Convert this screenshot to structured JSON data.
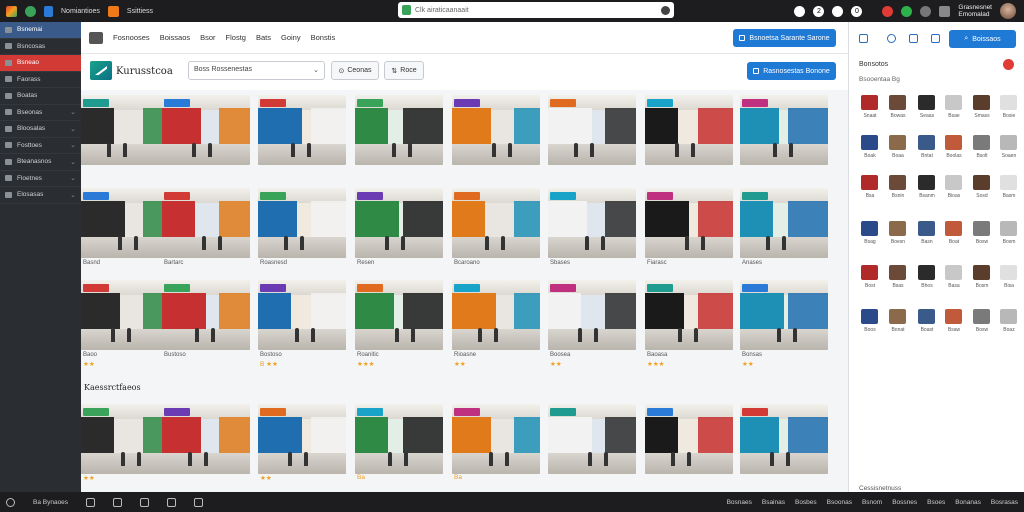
{
  "topbar": {
    "items": [
      {
        "icon": "app-logo-icon",
        "color": "#e8412c",
        "label": ""
      },
      {
        "icon": "leaf-icon",
        "color": "#3aa35a",
        "label": ""
      },
      {
        "icon": "bookmark-icon",
        "color": "#2a7ad8",
        "label": "Nomiantioes"
      },
      {
        "icon": "puzzle-icon",
        "color": "#f07a1a",
        "label": "Ssittiess"
      }
    ],
    "search_text": "Clk airaticaanaait",
    "right_glyphs": [
      "2",
      "0"
    ],
    "user_name_line1": "Grasnesnet",
    "user_name_line2": "Emomalad"
  },
  "sidebar": {
    "items": [
      {
        "label": "Bsnemai",
        "state": "active"
      },
      {
        "label": "Bsncosas",
        "state": ""
      },
      {
        "label": "Bsneao",
        "state": "red"
      },
      {
        "label": "Faorass",
        "state": ""
      },
      {
        "label": "Boatas",
        "state": ""
      },
      {
        "label": "Bseonas",
        "state": "chev"
      },
      {
        "label": "Bloosalas",
        "state": "chev"
      },
      {
        "label": "Fosttoes",
        "state": "chev"
      },
      {
        "label": "Bteanasnos",
        "state": "chev"
      },
      {
        "label": "Floetnes",
        "state": "chev"
      },
      {
        "label": "Elosasas",
        "state": "chev"
      }
    ]
  },
  "toolbar": {
    "links": [
      "Fosnooses",
      "Boissaos",
      "Bsor",
      "Flostg",
      "Bats",
      "Goiny",
      "Bonstis"
    ],
    "primary_button": "Bsnoetsa Sarante Sarone"
  },
  "brandrow": {
    "brand_name": "Kurusstcoa",
    "select_value": "Boss Rossenestas",
    "button1": "Ceonas",
    "button2": "Roce",
    "primary_button": "Rasnosestas Bonone"
  },
  "grid": {
    "rows": [
      [
        "",
        "",
        "",
        "",
        "",
        "",
        "",
        ""
      ],
      [
        "Basnd",
        "Bartarc",
        "Roasnesd",
        "Resen",
        "Bcaroano",
        "Sbases",
        "Fiarasc",
        "Anases"
      ],
      [
        "Baoo",
        "Bustoso",
        "Bostoso",
        "Roanitic",
        "Rioasne",
        "Boosea",
        "Baoasa",
        "Bonsas"
      ]
    ],
    "row2_stars": [
      "★★",
      "",
      "B ★★",
      "★★★",
      "★★",
      "★★",
      "★★★",
      "★★"
    ],
    "row4_captions": [
      "★★",
      "",
      "★★",
      "Ba",
      "Ba",
      "",
      "",
      ""
    ]
  },
  "section_title": "Kaessrctfaeos",
  "rpanel": {
    "title": "Bonsotos",
    "subtitle": "Bsooentaa Bg",
    "captions": [
      [
        "Snaat",
        "Bowas",
        "Seaas",
        "Bsae",
        "Smass",
        "Bosie"
      ],
      [
        "Boak",
        "Boaa",
        "Bntat",
        "Boolas",
        "Bsolt",
        "Soaen"
      ],
      [
        "Bsa",
        "Bsnin",
        "Bsanm",
        "Bioas",
        "Sosd",
        "Basm"
      ],
      [
        "Bsag",
        "Boesn",
        "Basn",
        "Boat",
        "Bosw",
        "Bosm"
      ],
      [
        "Bost",
        "Bsas",
        "Bhos",
        "Basa",
        "Bosm",
        "Bisa"
      ],
      [
        "Boos",
        "Bonat",
        "Boast",
        "Bsaw",
        "Bosw",
        "Boaz"
      ]
    ],
    "footer": "Cessisnetnuss"
  },
  "bottombar": {
    "left_label": "Ba Bynaoes",
    "right_labels": [
      "Bosnaes",
      "Bsainas",
      "Bosbes",
      "Bsoonas",
      "Bsnom",
      "Bossnes",
      "Bsoes",
      "Bonanas",
      "Bosrasas"
    ]
  },
  "colors": {
    "accent": "#1f7ad6",
    "sidebar": "#2a2d31",
    "danger": "#d23a35"
  }
}
